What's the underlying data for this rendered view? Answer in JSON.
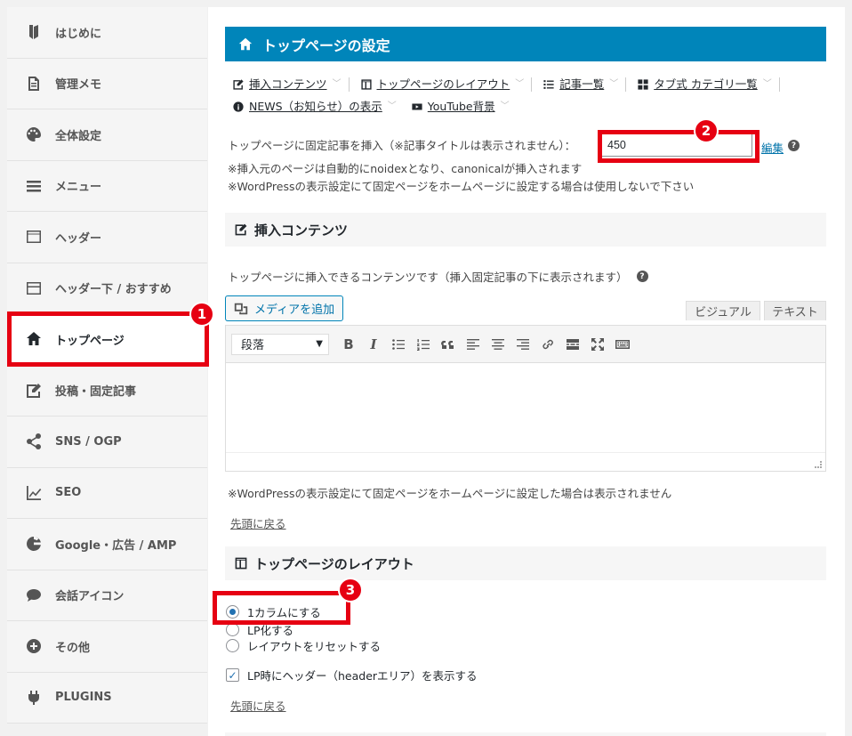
{
  "sidebar": {
    "items": [
      {
        "label": "はじめに",
        "icon": "bookmark-icon"
      },
      {
        "label": "管理メモ",
        "icon": "document-icon"
      },
      {
        "label": "全体設定",
        "icon": "palette-icon"
      },
      {
        "label": "メニュー",
        "icon": "menu-icon"
      },
      {
        "label": "ヘッダー",
        "icon": "header-icon"
      },
      {
        "label": "ヘッダー下 / おすすめ",
        "icon": "header-below-icon"
      },
      {
        "label": "トップページ",
        "icon": "home-icon"
      },
      {
        "label": "投稿・固定記事",
        "icon": "edit-icon"
      },
      {
        "label": "SNS / OGP",
        "icon": "share-icon"
      },
      {
        "label": "SEO",
        "icon": "chart-icon"
      },
      {
        "label": "Google・広告 / AMP",
        "icon": "google-icon"
      },
      {
        "label": "会話アイコン",
        "icon": "chat-icon"
      },
      {
        "label": "その他",
        "icon": "plus-circle-icon"
      },
      {
        "label": "PLUGINS",
        "icon": "plug-icon"
      }
    ],
    "active_index": 6
  },
  "page": {
    "title": "トップページの設定"
  },
  "tabs": [
    {
      "label": "挿入コンテンツ",
      "icon": "edit-icon"
    },
    {
      "label": "トップページのレイアウト",
      "icon": "layout-icon"
    },
    {
      "label": "記事一覧",
      "icon": "list-icon"
    },
    {
      "label": "タブ式 カテゴリ一覧",
      "icon": "grid-icon"
    },
    {
      "label": "NEWS（お知らせ）の表示",
      "icon": "info-icon"
    },
    {
      "label": "YouTube背景",
      "icon": "youtube-icon"
    }
  ],
  "fixed_post": {
    "label": "トップページに固定記事を挿入（※記事タイトルは表示されません）：",
    "value": "450",
    "edit_link": "編集",
    "help": "?",
    "notes": [
      "※挿入元のページは自動的にnoidexとなり、canonicalが挿入されます",
      "※WordPressの表示設定にて固定ページをホームページに設定する場合は使用しないで下さい"
    ]
  },
  "insert_content": {
    "heading": "挿入コンテンツ",
    "description": "トップページに挿入できるコンテンツです（挿入固定記事の下に表示されます）",
    "help": "?",
    "media_button": "メディアを追加",
    "tab_visual": "ビジュアル",
    "tab_text": "テキスト",
    "format_select": "段落",
    "note": "※WordPressの表示設定にて固定ページをホームページに設定した場合は表示されません",
    "back_link": "先頭に戻る"
  },
  "layout": {
    "heading": "トップページのレイアウト",
    "options": [
      "1カラムにする",
      "LP化する",
      "レイアウトをリセットする"
    ],
    "selected_index": 0,
    "checkbox_label": "LP時にヘッダー（headerエリア）を表示する",
    "checkbox_checked": true,
    "back_link": "先頭に戻る"
  },
  "annotations": [
    {
      "number": "1",
      "color": "#e60012"
    },
    {
      "number": "2",
      "color": "#e60012"
    },
    {
      "number": "3",
      "color": "#e60012"
    }
  ],
  "colors": {
    "title_bar": "#0085ba",
    "link": "#0073aa",
    "highlight": "#e60012"
  }
}
